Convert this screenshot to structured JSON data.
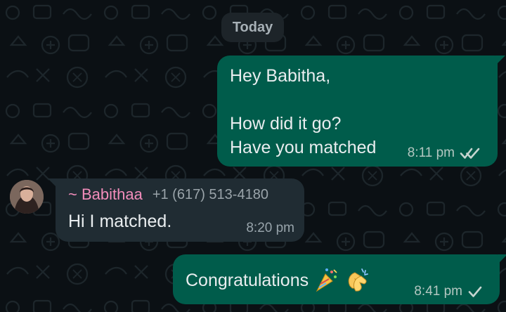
{
  "date_separator": "Today",
  "messages": [
    {
      "text": "Hey Babitha,\n\nHow did it go?\nHave you matched",
      "time": "8:11 pm"
    },
    {
      "sender_name": "~ Babithaa",
      "sender_phone": "+1 (617) 513-4180",
      "text": "Hi I matched.",
      "time": "8:20 pm"
    },
    {
      "text": "Congratulations",
      "time": "8:41 pm"
    }
  ],
  "colors": {
    "background": "#0b1014",
    "outgoing_bubble": "#005c4b",
    "incoming_bubble": "#202c33",
    "sender_name": "#f28dbb",
    "date_pill": "#1d2429"
  },
  "icons": {
    "message_1_status": "double-tick-icon",
    "message_3_status": "single-tick-icon",
    "emoji_1": "party-popper-icon",
    "emoji_2": "clapping-hands-icon"
  }
}
